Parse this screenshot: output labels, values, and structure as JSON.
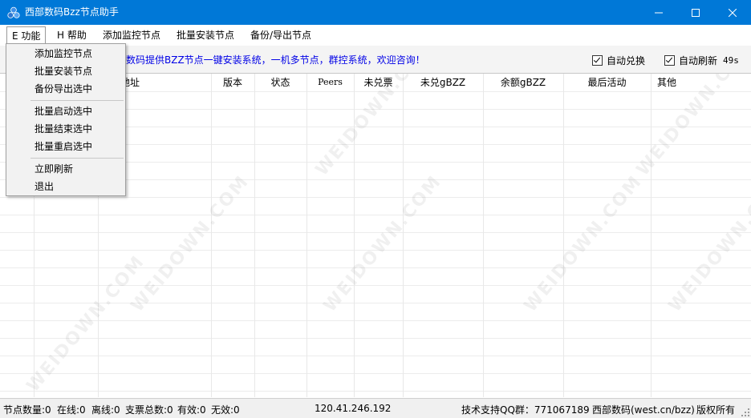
{
  "window": {
    "title": "西部数码Bzz节点助手",
    "controls": {
      "minimize_icon": "minimize-icon",
      "maximize_icon": "maximize-icon",
      "close_icon": "close-icon"
    }
  },
  "menubar": {
    "items": [
      {
        "label": "E 功能",
        "active": true
      },
      {
        "label": "H 帮助"
      },
      {
        "label": "添加监控节点"
      },
      {
        "label": "批量安装节点"
      },
      {
        "label": "备份/导出节点"
      }
    ]
  },
  "function_menu": {
    "groups": [
      [
        "添加监控节点",
        "批量安装节点",
        "备份导出选中"
      ],
      [
        "批量启动选中",
        "批量结束选中",
        "批量重启选中"
      ],
      [
        "立即刷新",
        "退出"
      ]
    ]
  },
  "infobar": {
    "message": "数码提供BZZ节点一键安装系统，一机多节点，群控系统，欢迎咨询！",
    "auto_exchange_label": "自动兑换",
    "auto_exchange_checked": true,
    "auto_refresh_label": "自动刷新",
    "auto_refresh_checked": true,
    "countdown": "49s"
  },
  "table": {
    "columns": [
      "",
      "",
      "地址",
      "版本",
      "状态",
      "Peers",
      "未兑票",
      "未兑gBZZ",
      "余额gBZZ",
      "最后活动",
      "其他"
    ],
    "rows": []
  },
  "statusbar": {
    "node_count": "节点数量:0",
    "online": "在线:0",
    "offline": "离线:0",
    "tickets_total": "支票总数:0",
    "valid": "有效:0",
    "invalid": "无效:0",
    "ip": "120.41.246.192",
    "support": "技术支持QQ群：771067189",
    "company": "西部数码(west.cn/bzz)",
    "rights": "版权所有"
  },
  "watermark": "WEIDOWN.COM",
  "colors": {
    "titlebar": "#0078d7",
    "info_text": "#0000e6"
  }
}
